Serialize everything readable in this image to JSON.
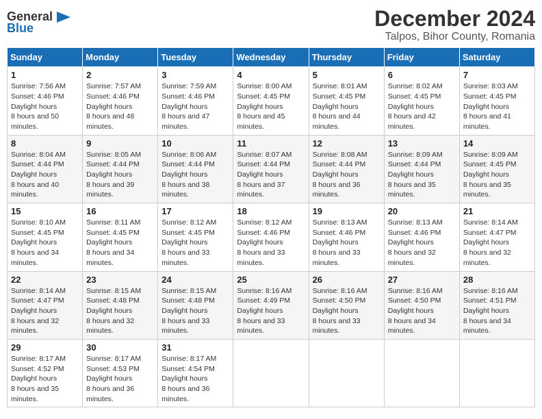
{
  "logo": {
    "general": "General",
    "blue": "Blue",
    "arrow_symbol": "▶"
  },
  "title": "December 2024",
  "location": "Talpos, Bihor County, Romania",
  "weekdays": [
    "Sunday",
    "Monday",
    "Tuesday",
    "Wednesday",
    "Thursday",
    "Friday",
    "Saturday"
  ],
  "weeks": [
    [
      {
        "day": "1",
        "sunrise": "7:56 AM",
        "sunset": "4:46 PM",
        "daylight": "8 hours and 50 minutes."
      },
      {
        "day": "2",
        "sunrise": "7:57 AM",
        "sunset": "4:46 PM",
        "daylight": "8 hours and 48 minutes."
      },
      {
        "day": "3",
        "sunrise": "7:59 AM",
        "sunset": "4:46 PM",
        "daylight": "8 hours and 47 minutes."
      },
      {
        "day": "4",
        "sunrise": "8:00 AM",
        "sunset": "4:45 PM",
        "daylight": "8 hours and 45 minutes."
      },
      {
        "day": "5",
        "sunrise": "8:01 AM",
        "sunset": "4:45 PM",
        "daylight": "8 hours and 44 minutes."
      },
      {
        "day": "6",
        "sunrise": "8:02 AM",
        "sunset": "4:45 PM",
        "daylight": "8 hours and 42 minutes."
      },
      {
        "day": "7",
        "sunrise": "8:03 AM",
        "sunset": "4:45 PM",
        "daylight": "8 hours and 41 minutes."
      }
    ],
    [
      {
        "day": "8",
        "sunrise": "8:04 AM",
        "sunset": "4:44 PM",
        "daylight": "8 hours and 40 minutes."
      },
      {
        "day": "9",
        "sunrise": "8:05 AM",
        "sunset": "4:44 PM",
        "daylight": "8 hours and 39 minutes."
      },
      {
        "day": "10",
        "sunrise": "8:06 AM",
        "sunset": "4:44 PM",
        "daylight": "8 hours and 38 minutes."
      },
      {
        "day": "11",
        "sunrise": "8:07 AM",
        "sunset": "4:44 PM",
        "daylight": "8 hours and 37 minutes."
      },
      {
        "day": "12",
        "sunrise": "8:08 AM",
        "sunset": "4:44 PM",
        "daylight": "8 hours and 36 minutes."
      },
      {
        "day": "13",
        "sunrise": "8:09 AM",
        "sunset": "4:44 PM",
        "daylight": "8 hours and 35 minutes."
      },
      {
        "day": "14",
        "sunrise": "8:09 AM",
        "sunset": "4:45 PM",
        "daylight": "8 hours and 35 minutes."
      }
    ],
    [
      {
        "day": "15",
        "sunrise": "8:10 AM",
        "sunset": "4:45 PM",
        "daylight": "8 hours and 34 minutes."
      },
      {
        "day": "16",
        "sunrise": "8:11 AM",
        "sunset": "4:45 PM",
        "daylight": "8 hours and 34 minutes."
      },
      {
        "day": "17",
        "sunrise": "8:12 AM",
        "sunset": "4:45 PM",
        "daylight": "8 hours and 33 minutes."
      },
      {
        "day": "18",
        "sunrise": "8:12 AM",
        "sunset": "4:46 PM",
        "daylight": "8 hours and 33 minutes."
      },
      {
        "day": "19",
        "sunrise": "8:13 AM",
        "sunset": "4:46 PM",
        "daylight": "8 hours and 33 minutes."
      },
      {
        "day": "20",
        "sunrise": "8:13 AM",
        "sunset": "4:46 PM",
        "daylight": "8 hours and 32 minutes."
      },
      {
        "day": "21",
        "sunrise": "8:14 AM",
        "sunset": "4:47 PM",
        "daylight": "8 hours and 32 minutes."
      }
    ],
    [
      {
        "day": "22",
        "sunrise": "8:14 AM",
        "sunset": "4:47 PM",
        "daylight": "8 hours and 32 minutes."
      },
      {
        "day": "23",
        "sunrise": "8:15 AM",
        "sunset": "4:48 PM",
        "daylight": "8 hours and 32 minutes."
      },
      {
        "day": "24",
        "sunrise": "8:15 AM",
        "sunset": "4:48 PM",
        "daylight": "8 hours and 33 minutes."
      },
      {
        "day": "25",
        "sunrise": "8:16 AM",
        "sunset": "4:49 PM",
        "daylight": "8 hours and 33 minutes."
      },
      {
        "day": "26",
        "sunrise": "8:16 AM",
        "sunset": "4:50 PM",
        "daylight": "8 hours and 33 minutes."
      },
      {
        "day": "27",
        "sunrise": "8:16 AM",
        "sunset": "4:50 PM",
        "daylight": "8 hours and 34 minutes."
      },
      {
        "day": "28",
        "sunrise": "8:16 AM",
        "sunset": "4:51 PM",
        "daylight": "8 hours and 34 minutes."
      }
    ],
    [
      {
        "day": "29",
        "sunrise": "8:17 AM",
        "sunset": "4:52 PM",
        "daylight": "8 hours and 35 minutes."
      },
      {
        "day": "30",
        "sunrise": "8:17 AM",
        "sunset": "4:53 PM",
        "daylight": "8 hours and 36 minutes."
      },
      {
        "day": "31",
        "sunrise": "8:17 AM",
        "sunset": "4:54 PM",
        "daylight": "8 hours and 36 minutes."
      },
      null,
      null,
      null,
      null
    ]
  ]
}
